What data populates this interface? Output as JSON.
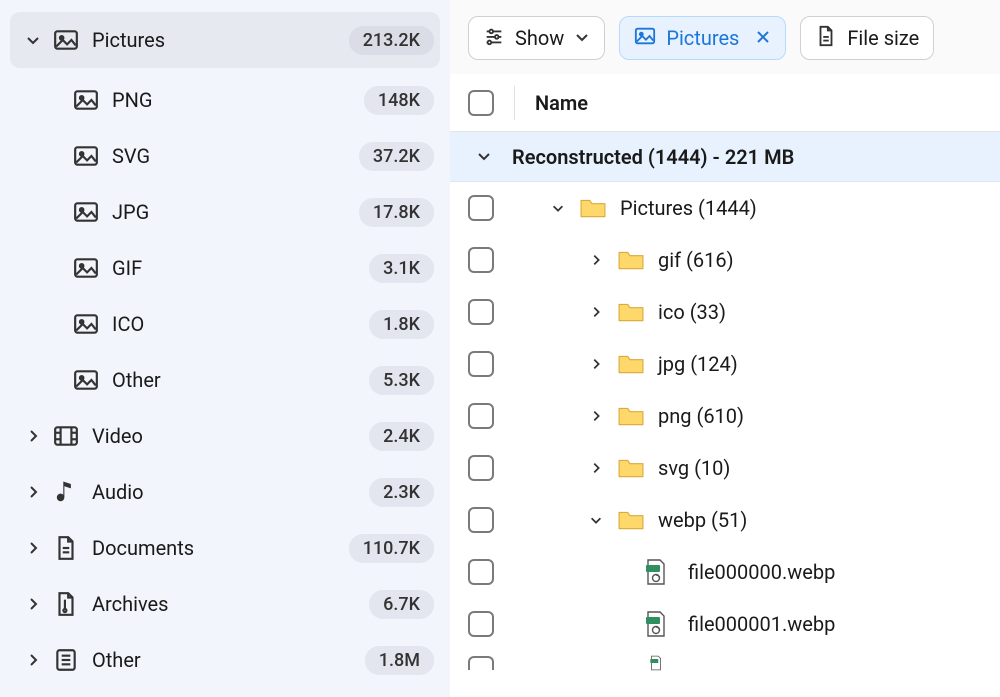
{
  "sidebar": {
    "pictures": {
      "label": "Pictures",
      "count": "213.2K"
    },
    "children": [
      {
        "label": "PNG",
        "count": "148K"
      },
      {
        "label": "SVG",
        "count": "37.2K"
      },
      {
        "label": "JPG",
        "count": "17.8K"
      },
      {
        "label": "GIF",
        "count": "3.1K"
      },
      {
        "label": "ICO",
        "count": "1.8K"
      },
      {
        "label": "Other",
        "count": "5.3K"
      }
    ],
    "video": {
      "label": "Video",
      "count": "2.4K"
    },
    "audio": {
      "label": "Audio",
      "count": "2.3K"
    },
    "documents": {
      "label": "Documents",
      "count": "110.7K"
    },
    "archives": {
      "label": "Archives",
      "count": "6.7K"
    },
    "other": {
      "label": "Other",
      "count": "1.8M"
    }
  },
  "toolbar": {
    "show": "Show",
    "filter": "Pictures",
    "filesize": "File size"
  },
  "header": {
    "name": "Name"
  },
  "group": {
    "label": "Reconstructed (1444) - 221 MB"
  },
  "tree": {
    "root": "Pictures (1444)",
    "folders": [
      {
        "label": "gif (616)"
      },
      {
        "label": "ico (33)"
      },
      {
        "label": "jpg (124)"
      },
      {
        "label": "png (610)"
      },
      {
        "label": "svg (10)"
      },
      {
        "label": "webp (51)"
      }
    ],
    "files": [
      {
        "label": "file000000.webp"
      },
      {
        "label": "file000001.webp"
      }
    ]
  }
}
